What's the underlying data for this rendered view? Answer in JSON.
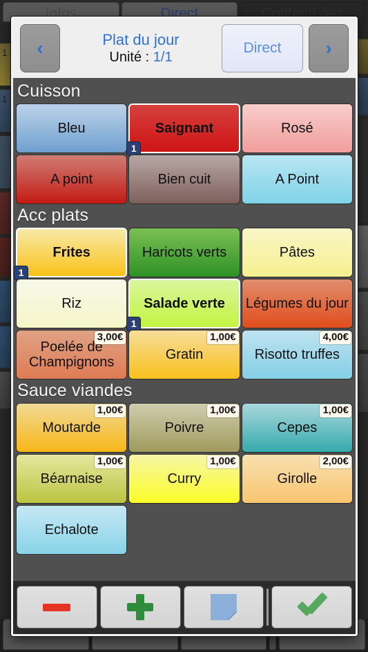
{
  "background": {
    "tabs": [
      {
        "label": "Infos"
      },
      {
        "label": "Direct"
      },
      {
        "label": "Contenu des"
      }
    ],
    "left_items": [
      {
        "qty": "1"
      },
      {
        "qty": "1"
      }
    ]
  },
  "header": {
    "prev_label": "‹",
    "next_label": "›",
    "title": "Plat du jour",
    "unit_label": "Unité : ",
    "unit_value": "1/1",
    "direct_label": "Direct"
  },
  "sections": [
    {
      "title": "Cuisson",
      "items": [
        {
          "label": "Bleu",
          "color_top": "#bdd2ea",
          "color_bottom": "#6f9fce",
          "selected": false,
          "badge": null,
          "price": null
        },
        {
          "label": "Saignant",
          "color_top": "#d5403d",
          "color_bottom": "#cf1416",
          "selected": true,
          "badge": "1",
          "price": null
        },
        {
          "label": "Rosé",
          "color_top": "#f8cdcb",
          "color_bottom": "#f09e9c",
          "selected": false,
          "badge": null,
          "price": null
        },
        {
          "label": "A point",
          "color_top": "#cf7d75",
          "color_bottom": "#c21a13",
          "selected": false,
          "badge": null,
          "price": null
        },
        {
          "label": "Bien cuit",
          "color_top": "#b7a8a5",
          "color_bottom": "#7e5f5c",
          "selected": false,
          "badge": null,
          "price": null
        },
        {
          "label": "A Point",
          "color_top": "#b8e5f2",
          "color_bottom": "#7fd3e8",
          "selected": false,
          "badge": null,
          "price": null
        }
      ]
    },
    {
      "title": "Acc plats",
      "items": [
        {
          "label": "Frites",
          "color_top": "#f7e9a8",
          "color_bottom": "#f9c218",
          "selected": true,
          "badge": "1",
          "price": null
        },
        {
          "label": "Haricots verts",
          "color_top": "#7cbf54",
          "color_bottom": "#2e9224",
          "selected": false,
          "badge": null,
          "price": null
        },
        {
          "label": "Pâtes",
          "color_top": "#f8f6c7",
          "color_bottom": "#f6f08e",
          "selected": false,
          "badge": null,
          "price": null
        },
        {
          "label": "Riz",
          "color_top": "#f7f8ea",
          "color_bottom": "#f6f6c9",
          "selected": false,
          "badge": null,
          "price": null
        },
        {
          "label": "Salade verte",
          "color_top": "#d9f59c",
          "color_bottom": "#c4f442",
          "selected": true,
          "badge": "1",
          "price": null
        },
        {
          "label": "Légumes du jour",
          "color_top": "#e08d6d",
          "color_bottom": "#e04e1c",
          "selected": false,
          "badge": null,
          "price": null
        },
        {
          "label": "Poelée de Champignons",
          "color_top": "#e0a284",
          "color_bottom": "#dd7c54",
          "selected": false,
          "badge": null,
          "price": "3,00€"
        },
        {
          "label": "Gratin",
          "color_top": "#f6dd9a",
          "color_bottom": "#f9c11c",
          "selected": false,
          "badge": null,
          "price": "1,00€"
        },
        {
          "label": "Risotto truffes",
          "color_top": "#bfe3f0",
          "color_bottom": "#85cfe6",
          "selected": false,
          "badge": null,
          "price": "4,00€"
        }
      ]
    },
    {
      "title": "Sauce viandes",
      "items": [
        {
          "label": "Moutarde",
          "color_top": "#f0d996",
          "color_bottom": "#f8b718",
          "selected": false,
          "badge": null,
          "price": "1,00€"
        },
        {
          "label": "Poivre",
          "color_top": "#cfcdae",
          "color_bottom": "#a09a5d",
          "selected": false,
          "badge": null,
          "price": "1,00€"
        },
        {
          "label": "Cepes",
          "color_top": "#a9d7dc",
          "color_bottom": "#36aaad",
          "selected": false,
          "badge": null,
          "price": "1,00€"
        },
        {
          "label": "Béarnaise",
          "color_top": "#e4e79e",
          "color_bottom": "#bcc442",
          "selected": false,
          "badge": null,
          "price": "1,00€"
        },
        {
          "label": "Curry",
          "color_top": "#f6f6a6",
          "color_bottom": "#fcfc28",
          "selected": false,
          "badge": null,
          "price": "1,00€"
        },
        {
          "label": "Girolle",
          "color_top": "#f7e0b1",
          "color_bottom": "#fac56f",
          "selected": false,
          "badge": null,
          "price": "2,00€"
        },
        {
          "label": "Echalote",
          "color_top": "#c6e8f3",
          "color_bottom": "#88d3e9",
          "selected": false,
          "badge": null,
          "price": null
        }
      ]
    }
  ],
  "footer": {
    "actions": [
      {
        "name": "decrement",
        "icon": "minus-icon"
      },
      {
        "name": "increment",
        "icon": "plus-icon"
      },
      {
        "name": "note",
        "icon": "note-icon"
      },
      {
        "name": "validate",
        "icon": "check-icon"
      }
    ]
  },
  "colors": {
    "accent_blue": "#2e72d2",
    "badge_navy": "#2b4073",
    "minus_red": "#e63323",
    "plus_green": "#2f8c3b",
    "check_green": "#56a85e",
    "note_blue": "#8cb0da"
  }
}
